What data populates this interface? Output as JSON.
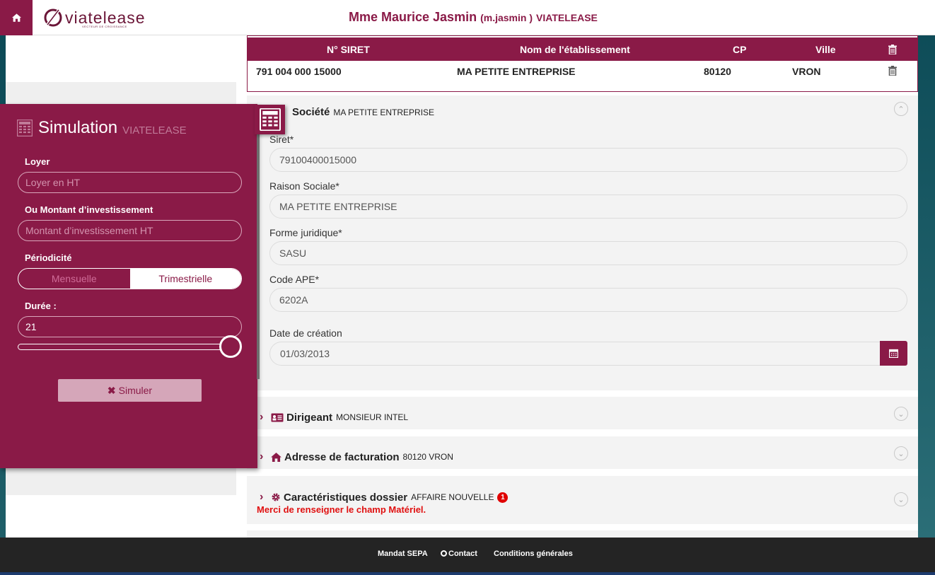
{
  "header": {
    "logo_text": "viatelease",
    "logo_tagline": "VECTEUR DE CROISSANCE",
    "user_name": "Mme Maurice Jasmin",
    "user_login": "(m.jasmin )",
    "user_org": "VIATELEASE"
  },
  "simulation": {
    "title": "Simulation",
    "org": "VIATELEASE",
    "loyer_label": "Loyer",
    "loyer_placeholder": "Loyer en HT",
    "montant_label": "Ou Montant d’investissement",
    "montant_placeholder": "Montant d’investissement HT",
    "periodicite_label": "Périodicité",
    "periodicite_options": [
      "Mensuelle",
      "Trimestrielle"
    ],
    "periodicite_selected": "Trimestrielle",
    "duree_label": "Durée :",
    "duree_value": "21",
    "duree_slider_fraction": 1.0,
    "simuler_label": "Simuler"
  },
  "siret_table": {
    "columns": [
      "N° SIRET",
      "Nom de l'établissement",
      "CP",
      "Ville"
    ],
    "rows": [
      {
        "siret": "791 004 000 15000",
        "nom": "MA PETITE ENTREPRISE",
        "cp": "80120",
        "ville": "VRON"
      }
    ]
  },
  "societe": {
    "title": "Société",
    "subtitle": "MA PETITE ENTREPRISE",
    "fields": {
      "siret_label": "Siret*",
      "siret_value": "79100400015000",
      "raison_label": "Raison Sociale*",
      "raison_value": "MA PETITE ENTREPRISE",
      "forme_label": "Forme juridique*",
      "forme_value": "SASU",
      "ape_label": "Code APE*",
      "ape_value": "6202A",
      "date_label": "Date de création",
      "date_value": "01/03/2013"
    }
  },
  "dirigeant": {
    "title": "Dirigeant",
    "subtitle": "MONSIEUR INTEL"
  },
  "adresse": {
    "title": "Adresse de facturation",
    "subtitle": "80120 VRON"
  },
  "caracteristiques": {
    "title": "Caractéristiques dossier",
    "subtitle": "AFFAIRE NOUVELLE",
    "badge": "1",
    "error": "Merci de renseigner le champ Matériel."
  },
  "footer": {
    "links": [
      "Mandat SEPA",
      "Contact",
      "Conditions générales"
    ]
  },
  "colors": {
    "brand": "#8a1a47",
    "error": "#e01010",
    "footer": "#242424"
  }
}
